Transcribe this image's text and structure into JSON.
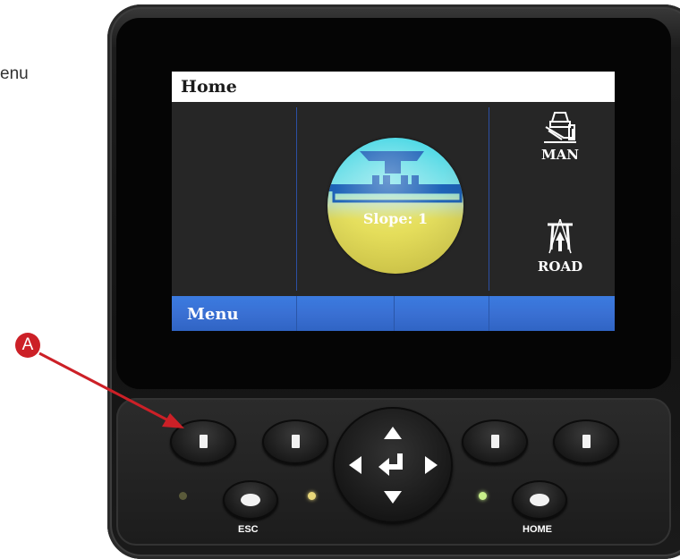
{
  "caption_fragment": "enu",
  "screen": {
    "title": "Home",
    "slope_label": "Slope: 1",
    "modes": [
      {
        "icon": "paver-manual-icon",
        "label": "MAN"
      },
      {
        "icon": "road-icon",
        "label": "ROAD"
      }
    ],
    "menu_label": "Menu"
  },
  "keypad": {
    "esc_label": "ESC",
    "home_label": "HOME"
  },
  "callout": {
    "letter": "A"
  },
  "colors": {
    "screen_background": "#262626",
    "menu_bar": "#3a70d3",
    "gauge_top": "#43d6e4",
    "gauge_bottom": "#e6dc52",
    "callout": "#cc2027",
    "led_left": "#5a5a3a",
    "led_mid": "#e8d77a",
    "led_right": "#c8f08a"
  }
}
